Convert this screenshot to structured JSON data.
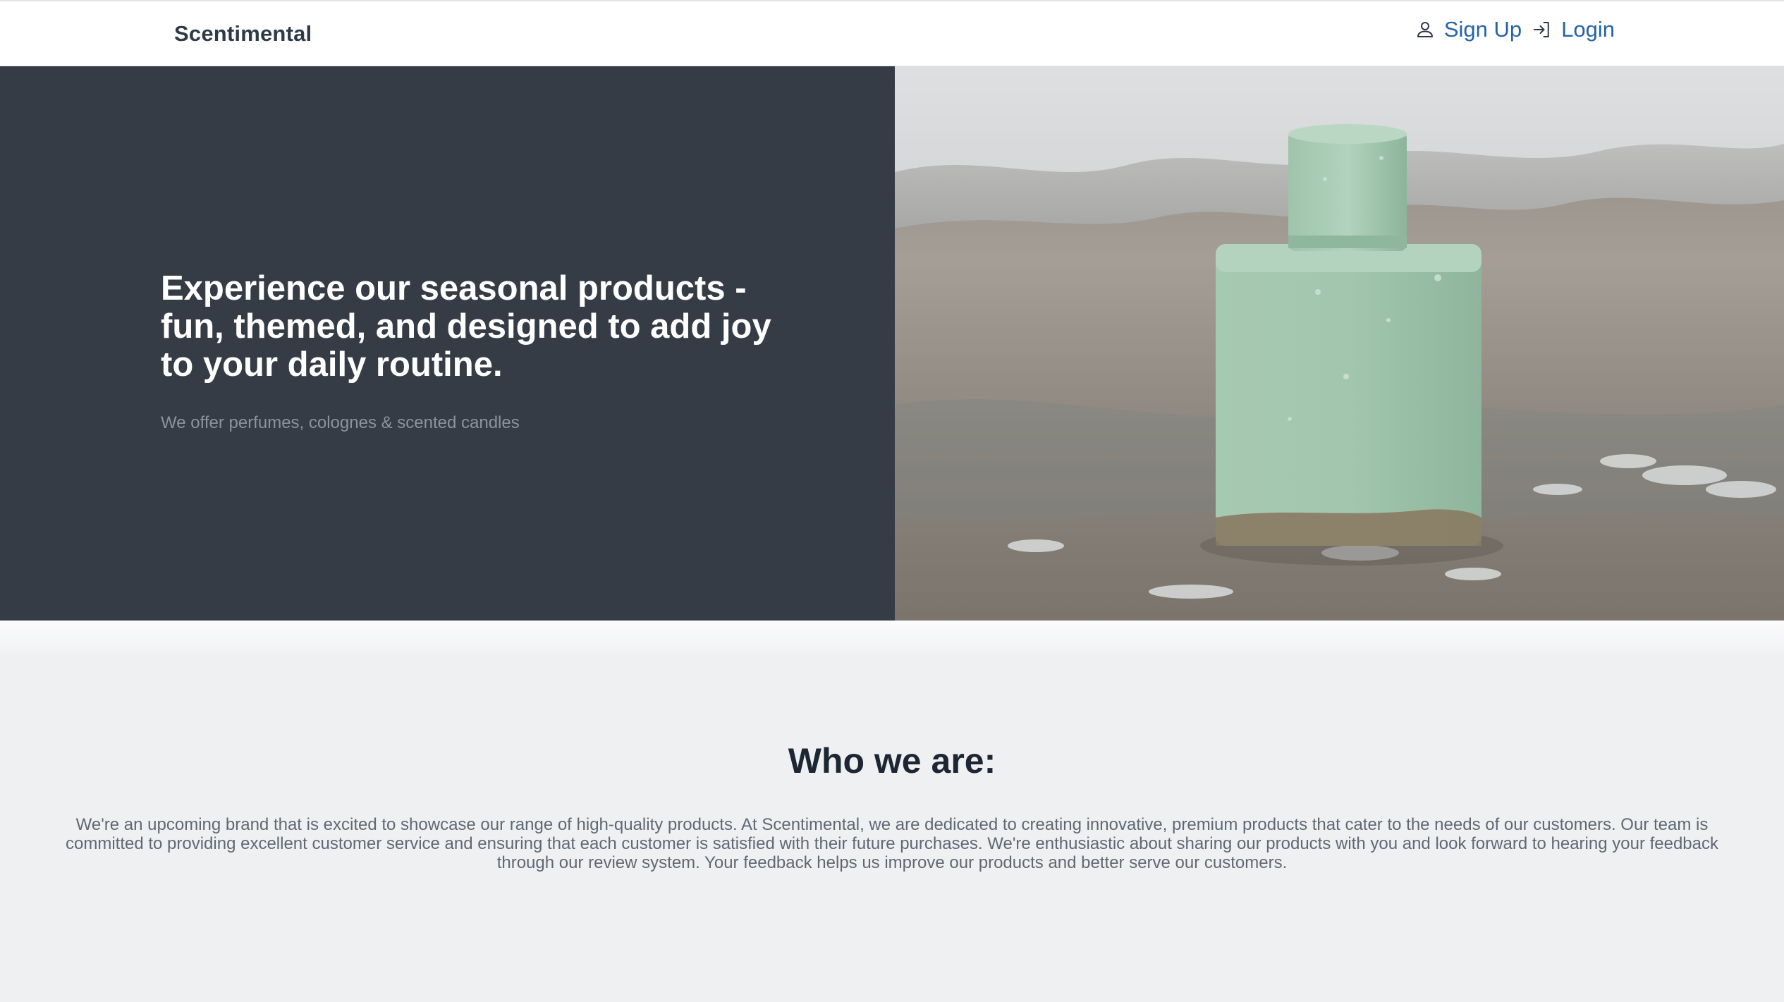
{
  "nav": {
    "brand": "Scentimental",
    "signup_label": "Sign Up",
    "login_label": "Login",
    "link_color": "#2563a8"
  },
  "hero": {
    "title": "Experience our seasonal products - fun, themed, and designed to add joy to your daily routine.",
    "subtitle": "We offer perfumes, colognes & scented candles",
    "background_color": "#363c45",
    "image": "green perfume bottle on wet beach sand with waves"
  },
  "about": {
    "title": "Who we are:",
    "text": "We're an upcoming brand that is excited to showcase our range of high-quality products. At Scentimental, we are dedicated to creating innovative, premium products that cater to the needs of our customers. Our team is committed to providing excellent customer service and ensuring that each customer is satisfied with their future purchases. We're enthusiastic about sharing our products with you and look forward to hearing your feedback through our review system. Your feedback helps us improve our products and better serve our customers."
  }
}
